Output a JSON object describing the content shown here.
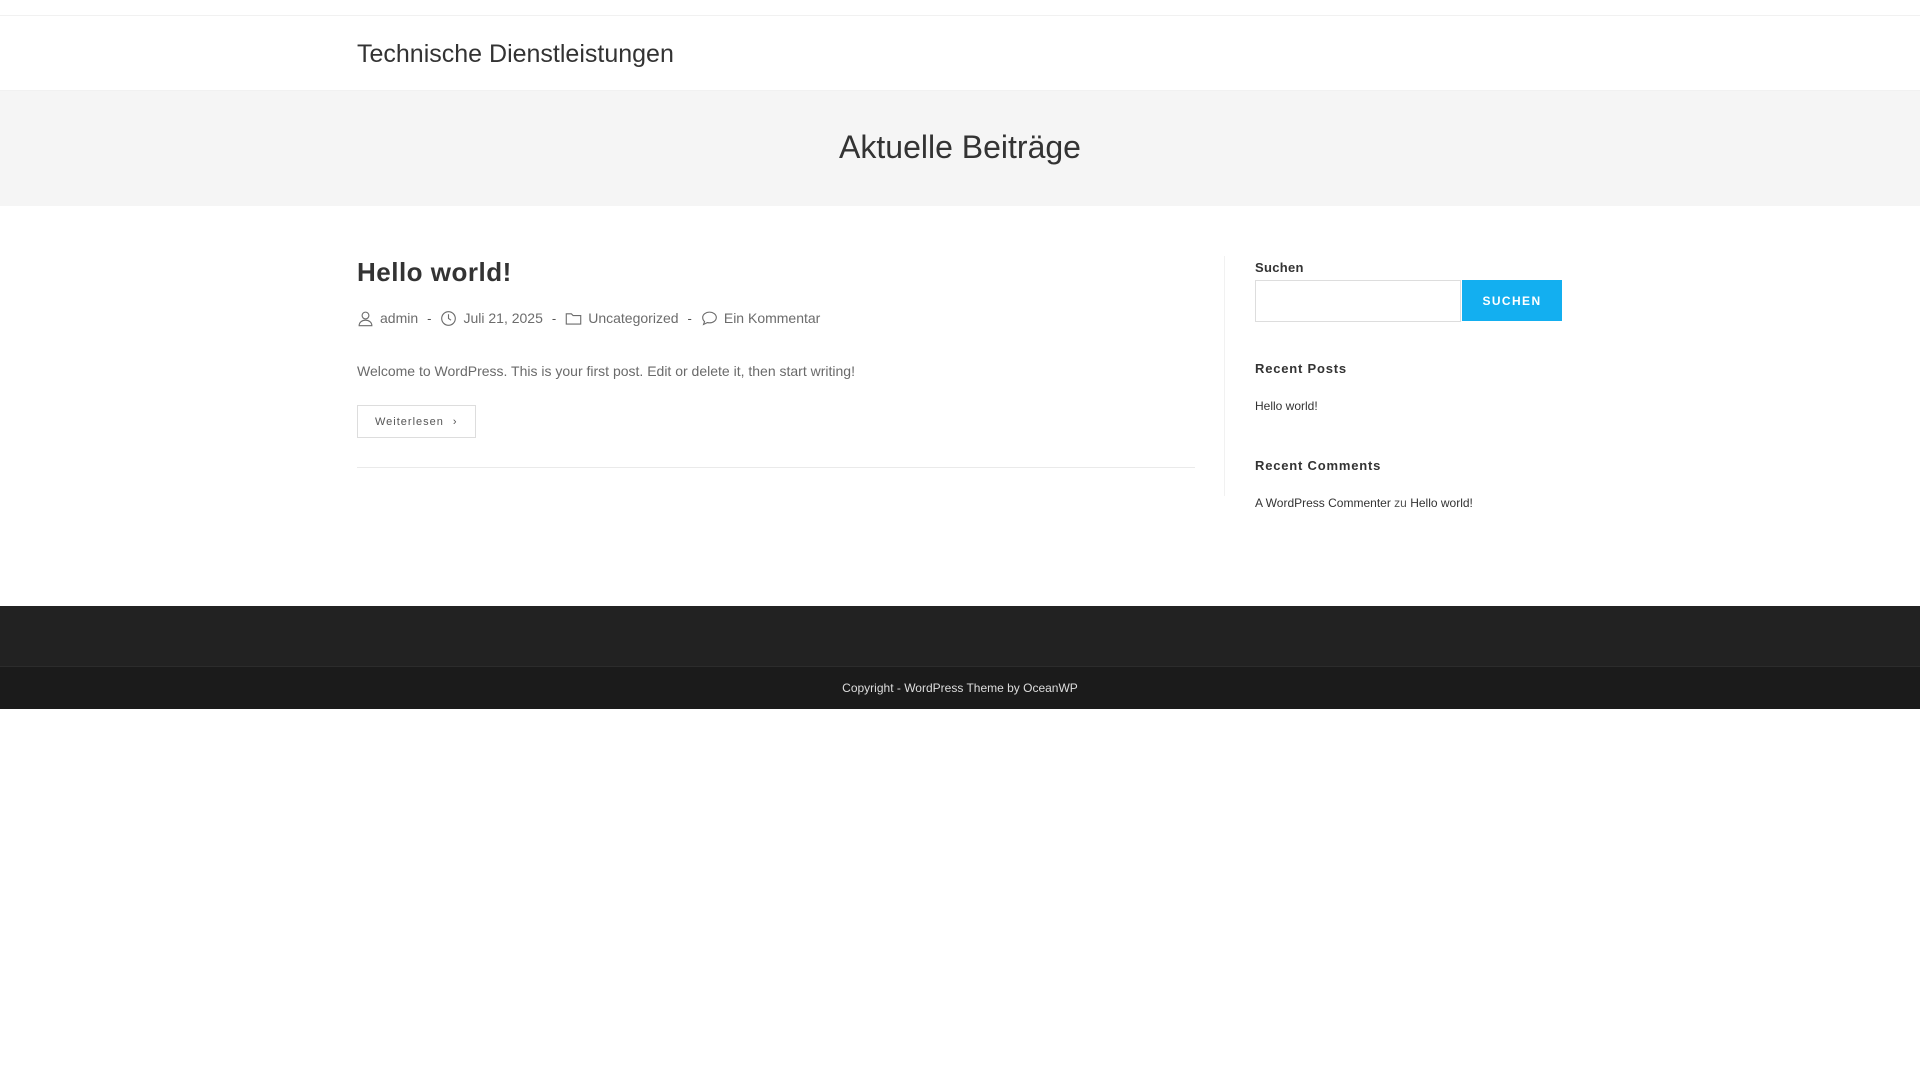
{
  "header": {
    "site_title": "Technische Dienstleistungen"
  },
  "page_header": {
    "title": "Aktuelle Beiträge"
  },
  "post": {
    "title": "Hello world!",
    "meta": {
      "author": "admin",
      "date": "Juli 21, 2025",
      "category": "Uncategorized",
      "comments": "Ein Kommentar",
      "separator": "-"
    },
    "excerpt": "Welcome to WordPress. This is your first post. Edit or delete it, then start writing!",
    "read_more_label": "Weiterlesen",
    "read_more_icon": "chevron-right-icon"
  },
  "sidebar": {
    "search": {
      "label": "Suchen",
      "input_value": "",
      "button_label": "SUCHEN"
    },
    "recent_posts": {
      "title": "Recent Posts",
      "items": [
        "Hello world!"
      ]
    },
    "recent_comments": {
      "title": "Recent Comments",
      "items": [
        {
          "author": "A WordPress Commenter",
          "connector": "zu",
          "post": "Hello world!"
        }
      ]
    }
  },
  "footer": {
    "copyright": "Copyright - WordPress Theme by OceanWP"
  },
  "colors": {
    "accent": "#13aff0",
    "page_header_bg": "#f5f5f5",
    "footer_bg": "#222222",
    "text": "#333333"
  }
}
